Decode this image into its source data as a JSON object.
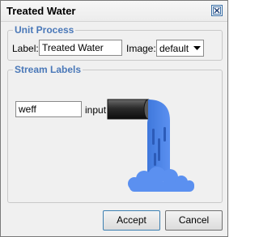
{
  "window": {
    "title": "Treated Water"
  },
  "unit_process": {
    "legend": "Unit Process",
    "label_caption": "Label:",
    "label_value": "Treated Water",
    "image_caption": "Image:",
    "image_value": "default"
  },
  "stream_labels": {
    "legend": "Stream Labels",
    "stream_value": "weff",
    "stream_caption": "input"
  },
  "buttons": {
    "accept": "Accept",
    "cancel": "Cancel"
  },
  "icons": {
    "close": "close-icon",
    "dropdown": "chevron-down-icon",
    "pipe": "effluent-pipe-image"
  },
  "colors": {
    "legend": "#4a78b8",
    "water": "#4a7fe0",
    "pipe": "#2a2a2a"
  }
}
